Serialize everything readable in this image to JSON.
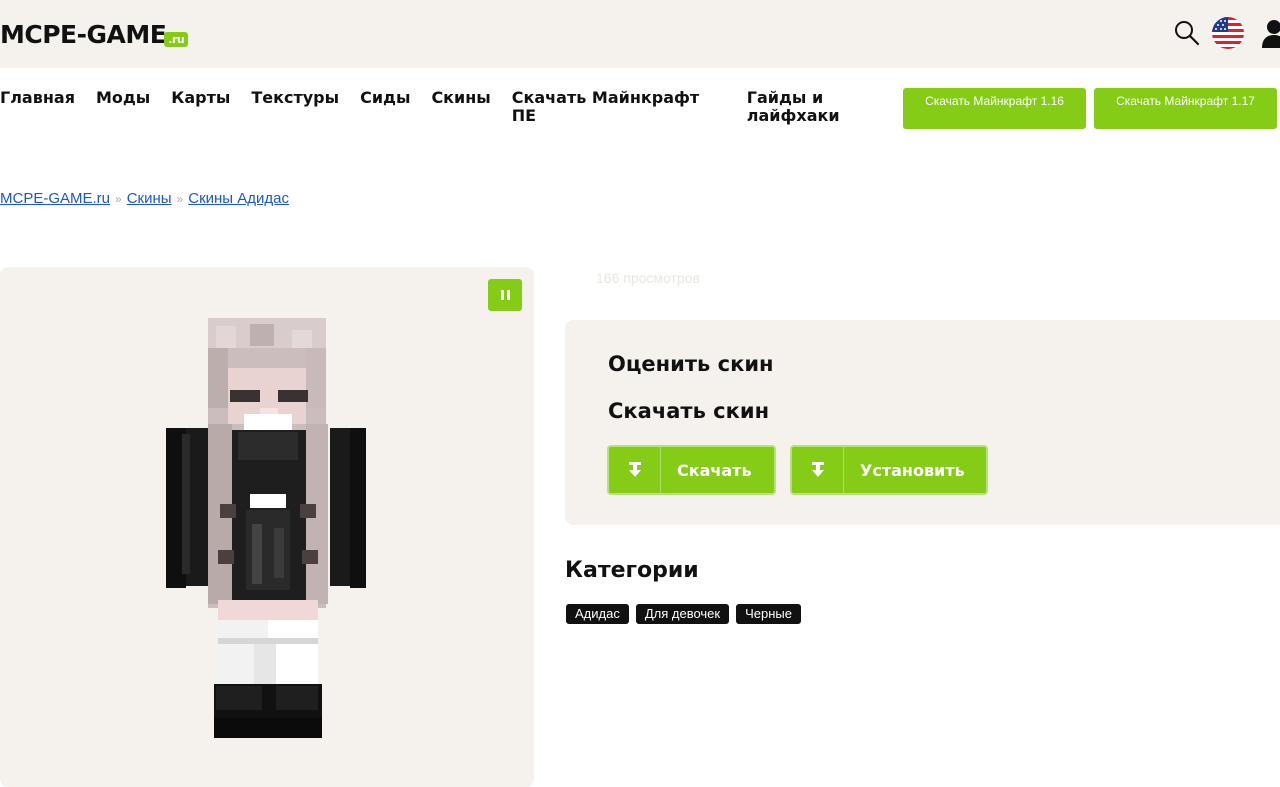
{
  "header": {
    "logo_text": "MCPE-GAME",
    "logo_suffix": ".ru",
    "icons": [
      "search-icon",
      "us-flag-icon",
      "user-icon"
    ]
  },
  "nav": {
    "items": [
      "Главная",
      "Моды",
      "Карты",
      "Текстуры",
      "Сиды",
      "Скины"
    ],
    "item_download_pe": "Скачать Майнкрафт ПЕ",
    "item_guides": "Гайды и лайфхаки"
  },
  "download_buttons": [
    {
      "label": "Скачать Майнкрафт 1.16"
    },
    {
      "label": "Скачать Майнкрафт 1.17"
    }
  ],
  "breadcrumbs": {
    "items": [
      "MCPE-GAME.ru",
      "Скины",
      "Скины Адидас"
    ],
    "separator": "»"
  },
  "skin": {
    "views": "166 просмотров",
    "rate_heading": "Оценить скин",
    "download_heading": "Скачать скин",
    "download_label": "Скачать",
    "install_label": "Установить"
  },
  "categories": {
    "heading": "Категории",
    "tags": [
      "Адидас",
      "Для девочек",
      "Черные"
    ]
  },
  "colors": {
    "accent": "#84cc16",
    "panel_bg": "#f5f2ee",
    "link": "#1a56db"
  }
}
